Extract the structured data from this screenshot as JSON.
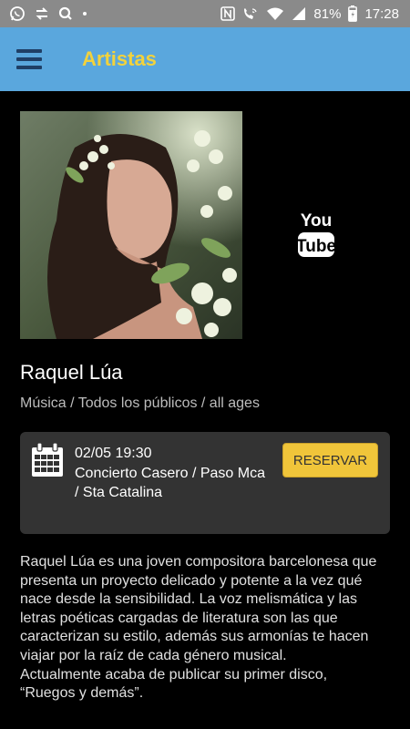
{
  "status_bar": {
    "left_icons": [
      "whatsapp-icon",
      "transfer-icon",
      "search-app-icon",
      "dot-icon"
    ],
    "battery": "81%",
    "time": "17:28"
  },
  "header": {
    "title": "Artistas"
  },
  "artist": {
    "name": "Raquel Lúa",
    "category": "Música / Todos los públicos / all ages",
    "video_link": {
      "top": "You",
      "bottom": "Tube"
    }
  },
  "event": {
    "datetime": "02/05 19:30",
    "place": "Concierto Casero / Paso Mca / Sta Catalina",
    "reserve_label": "RESERVAR"
  },
  "description": {
    "paragraph1": "Raquel Lúa es una joven compositora barcelonesa que presenta un proyecto delicado y potente a la vez qué nace desde la sensibilidad. La voz melismática y las letras poéticas cargadas de literatura son las que caracterizan su estilo, además sus armonías te hacen viajar por la raíz de cada género musical.",
    "paragraph2": "Actualmente acaba de publicar su primer disco, “Ruegos y demás”."
  },
  "colors": {
    "status_bar": "#8a8a8a",
    "app_bar": "#5aa7dd",
    "title": "#f2d23c",
    "accent_button": "#f0c53a",
    "card": "#333333"
  }
}
